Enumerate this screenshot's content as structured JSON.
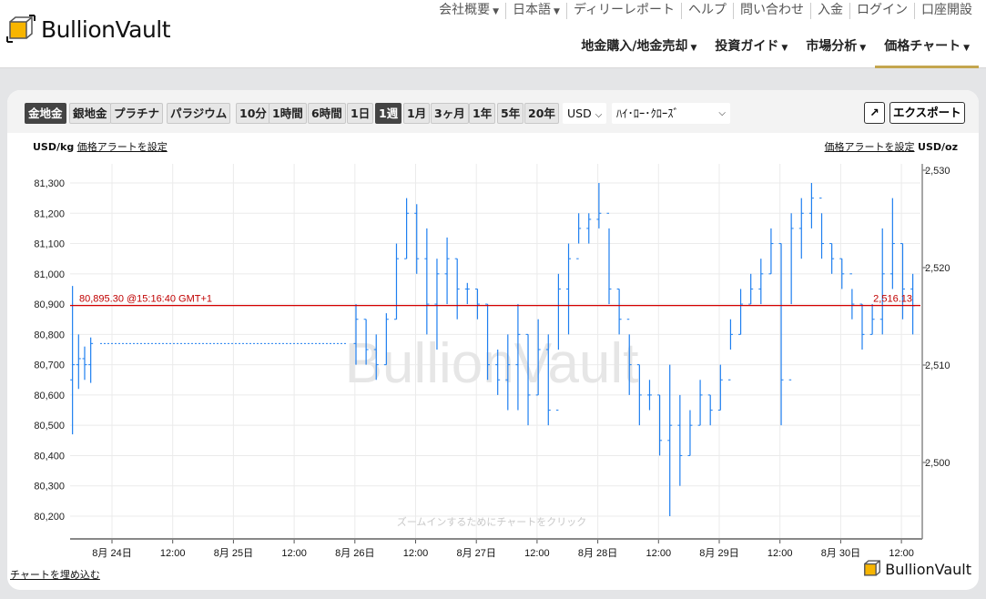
{
  "header": {
    "brand": "BullionVault",
    "top_nav": [
      {
        "label": "会社概要",
        "dropdown": true
      },
      {
        "label": "日本語",
        "dropdown": true
      },
      {
        "label": "ディリーレポート"
      },
      {
        "label": "ヘルプ"
      },
      {
        "label": "問い合わせ"
      },
      {
        "label": "入金"
      },
      {
        "label": "ログイン"
      },
      {
        "label": "口座開設"
      }
    ],
    "main_nav": [
      {
        "label": "地金購入/地金売却",
        "active": false
      },
      {
        "label": "投資ガイド",
        "active": false
      },
      {
        "label": "市場分析",
        "active": false
      },
      {
        "label": "価格チャート",
        "active": true
      }
    ]
  },
  "toolbar": {
    "metals": [
      {
        "label": "金地金",
        "active": true
      },
      {
        "label": "銀地金"
      },
      {
        "label": "プラチナ"
      },
      {
        "label": "パラジウム"
      }
    ],
    "ranges": [
      {
        "label": "10分"
      },
      {
        "label": "1時間"
      },
      {
        "label": "6時間"
      },
      {
        "label": "1日"
      },
      {
        "label": "1週",
        "active": true
      },
      {
        "label": "1月"
      },
      {
        "label": "3ヶ月"
      },
      {
        "label": "1年"
      },
      {
        "label": "5年"
      },
      {
        "label": "20年"
      }
    ],
    "currency": "USD",
    "chart_style": "ﾊｲ･ﾛｰ･ｸﾛｰｽﾞ",
    "export_label": "エクスポート",
    "popout_icon": "external-link-icon"
  },
  "chart_header": {
    "left_unit": "USD/kg",
    "right_unit": "USD/oz",
    "alert_link": "価格アラートを設定"
  },
  "footer": {
    "embed_link": "チャートを埋め込む",
    "brand": "BullionVault",
    "zoom_hint": "ズームインするためにチャートをクリック",
    "watermark": "BullionVault"
  },
  "colors": {
    "bars": "#1e7ff0",
    "last_price_line": "#d40000",
    "accent": "#c4a64e",
    "brand_gold": "#f7b500"
  },
  "chart_data": {
    "type": "ohlc",
    "left_axis": {
      "unit": "USD/kg",
      "ticks": [
        80200,
        80300,
        80400,
        80500,
        80600,
        80700,
        80800,
        80900,
        81000,
        81100,
        81200,
        81300
      ]
    },
    "right_axis": {
      "unit": "USD/oz",
      "ticks": [
        2500,
        2510,
        2520,
        2530
      ]
    },
    "x_ticks": [
      "8月 24日",
      "12:00",
      "8月 25日",
      "12:00",
      "8月 26日",
      "12:00",
      "8月 27日",
      "12:00",
      "8月 28日",
      "12:00",
      "8月 29日",
      "12:00",
      "8月 30日",
      "12:00"
    ],
    "last_price": {
      "kg": 80895.3,
      "label": "80,895.30 @15:16:40 GMT+1",
      "oz_label": "2,516.13"
    },
    "weekend_close": 80770,
    "pre_weekend": {
      "start": "08-23 16:00",
      "step_hours": 1.2,
      "bars": [
        [
          80650,
          80960,
          80470,
          80700
        ],
        [
          80700,
          80800,
          80620,
          80720
        ],
        [
          80720,
          80760,
          80650,
          80700
        ],
        [
          80700,
          80790,
          80640,
          80770
        ]
      ]
    },
    "main": {
      "start": "08-26 00:00",
      "step_hours": 2,
      "bars": [
        [
          80770,
          80900,
          80700,
          80850
        ],
        [
          80850,
          80850,
          80700,
          80750
        ],
        [
          80750,
          80800,
          80650,
          80700
        ],
        [
          80700,
          80870,
          80700,
          80850
        ],
        [
          80850,
          81100,
          80850,
          81050
        ],
        [
          81050,
          81250,
          81050,
          81200
        ],
        [
          81200,
          81230,
          81000,
          81050
        ],
        [
          81050,
          81150,
          80800,
          80900
        ],
        [
          80900,
          81050,
          80750,
          81000
        ],
        [
          81000,
          81120,
          80900,
          81050
        ],
        [
          81050,
          81050,
          80850,
          80950
        ],
        [
          80950,
          80970,
          80900,
          80950
        ],
        [
          80950,
          80950,
          80850,
          80900
        ],
        [
          80900,
          80900,
          80650,
          80700
        ],
        [
          80700,
          80750,
          80600,
          80650
        ],
        [
          80650,
          80800,
          80550,
          80700
        ],
        [
          80700,
          80900,
          80550,
          80800
        ],
        [
          80800,
          80800,
          80500,
          80600
        ],
        [
          80600,
          80850,
          80600,
          80750
        ],
        [
          80750,
          80800,
          80500,
          80550
        ],
        [
          80550,
          81000,
          80750,
          80950
        ],
        [
          80950,
          81100,
          80800,
          81050
        ],
        [
          81050,
          81200,
          81100,
          81150
        ],
        [
          81150,
          81200,
          81100,
          81180
        ],
        [
          81180,
          81300,
          81150,
          81200
        ],
        [
          81200,
          81150,
          80900,
          80950
        ],
        [
          80950,
          80950,
          80800,
          80850
        ],
        [
          80850,
          80800,
          80600,
          80700
        ],
        [
          80700,
          80700,
          80500,
          80600
        ],
        [
          80600,
          80650,
          80550,
          80600
        ],
        [
          80600,
          80600,
          80400,
          80450
        ],
        [
          80450,
          80700,
          80200,
          80500
        ],
        [
          80500,
          80600,
          80300,
          80400
        ],
        [
          80400,
          80550,
          80400,
          80500
        ],
        [
          80500,
          80650,
          80500,
          80600
        ],
        [
          80600,
          80600,
          80500,
          80550
        ],
        [
          80550,
          80700,
          80550,
          80650
        ],
        [
          80650,
          80850,
          80750,
          80800
        ],
        [
          80800,
          80950,
          80800,
          80900
        ],
        [
          80900,
          81000,
          80900,
          80950
        ],
        [
          80950,
          81050,
          80900,
          81000
        ],
        [
          81000,
          81150,
          81000,
          81100
        ],
        [
          81100,
          81100,
          80500,
          80650
        ],
        [
          80650,
          81200,
          80900,
          81150
        ],
        [
          81150,
          81250,
          81050,
          81200
        ],
        [
          81200,
          81300,
          81150,
          81250
        ],
        [
          81250,
          81200,
          81050,
          81100
        ],
        [
          81100,
          81100,
          81000,
          81050
        ],
        [
          81050,
          81050,
          80950,
          81000
        ],
        [
          81000,
          80950,
          80850,
          80900
        ],
        [
          80900,
          80900,
          80750,
          80800
        ],
        [
          80800,
          80900,
          80800,
          80850
        ],
        [
          80850,
          81150,
          80800,
          81000
        ],
        [
          81000,
          81250,
          80950,
          81100
        ],
        [
          81100,
          81100,
          80850,
          80950
        ],
        [
          80950,
          81000,
          80800,
          80895
        ]
      ]
    }
  }
}
